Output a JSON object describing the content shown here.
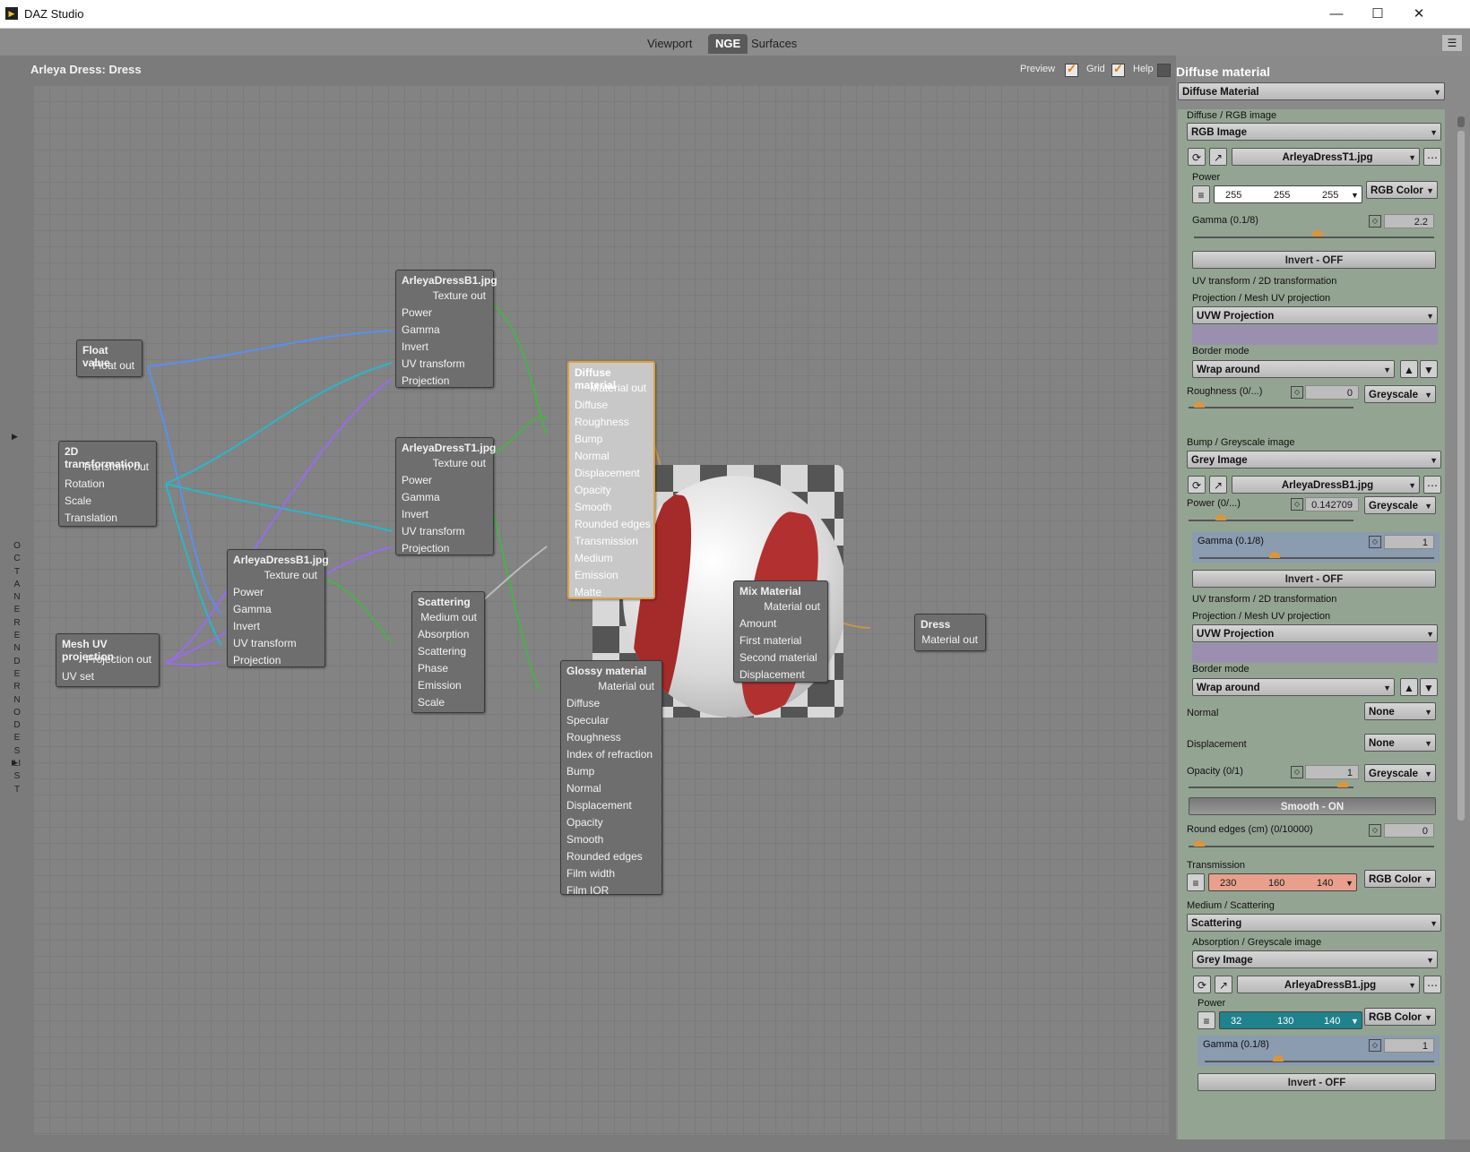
{
  "window": {
    "title": "DAZ Studio",
    "minimize": "—",
    "maximize": "☐",
    "close": "✕"
  },
  "tabs": [
    "Viewport",
    "NGE",
    "Surfaces"
  ],
  "header": {
    "node_title": "Arleya Dress: Dress",
    "preview_label": "Preview",
    "grid_label": "Grid",
    "help_label": "Help"
  },
  "sidebar": {
    "label": "OCTANE RENDER NODES LIST"
  },
  "nodes": {
    "float_value": {
      "title": "Float value",
      "out": "Float out"
    },
    "transform2d": {
      "title": "2D transformation",
      "out": "Transform out",
      "inputs": [
        "Rotation",
        "Scale",
        "Translation"
      ]
    },
    "mesh_uv": {
      "title": "Mesh UV projection",
      "out": "Projection out",
      "inputs": [
        "UV set"
      ]
    },
    "b1_top": {
      "title": "ArleyaDressB1.jpg",
      "out": "Texture out",
      "inputs": [
        "Power",
        "Gamma",
        "Invert",
        "UV transform",
        "Projection"
      ]
    },
    "t1": {
      "title": "ArleyaDressT1.jpg",
      "out": "Texture out",
      "inputs": [
        "Power",
        "Gamma",
        "Invert",
        "UV transform",
        "Projection"
      ]
    },
    "b1_bottom": {
      "title": "ArleyaDressB1.jpg",
      "out": "Texture out",
      "inputs": [
        "Power",
        "Gamma",
        "Invert",
        "UV transform",
        "Projection"
      ]
    },
    "scattering": {
      "title": "Scattering",
      "out": "Medium out",
      "inputs": [
        "Absorption",
        "Scattering",
        "Phase",
        "Emission",
        "Scale"
      ]
    },
    "diffuse": {
      "title": "Diffuse material",
      "out": "Material out",
      "inputs": [
        "Diffuse",
        "Roughness",
        "Bump",
        "Normal",
        "Displacement",
        "Opacity",
        "Smooth",
        "Rounded edges",
        "Transmission",
        "Medium",
        "Emission",
        "Matte"
      ]
    },
    "glossy": {
      "title": "Glossy material",
      "out": "Material out",
      "inputs": [
        "Diffuse",
        "Specular",
        "Roughness",
        "Index of refraction",
        "Bump",
        "Normal",
        "Displacement",
        "Opacity",
        "Smooth",
        "Rounded edges",
        "Film width",
        "Film IOR"
      ]
    },
    "mix": {
      "title": "Mix Material",
      "out": "Material out",
      "inputs": [
        "Amount",
        "First material",
        "Second material",
        "Displacement"
      ]
    },
    "dress": {
      "title": "Dress",
      "out": "Material out"
    }
  },
  "panel": {
    "title": "Diffuse material",
    "material_type": "Diffuse Material",
    "diffuse": {
      "label": "Diffuse / RGB image",
      "type": "RGB Image",
      "file": "ArleyaDressT1.jpg",
      "power_label": "Power",
      "power": [
        "255",
        "255",
        "255"
      ],
      "power_mode": "RGB Color",
      "gamma_label": "Gamma (0.1/8)",
      "gamma": "2.2",
      "invert": "Invert - OFF",
      "uv_label": "UV transform / 2D transformation",
      "proj_label": "Projection / Mesh UV projection",
      "proj": "UVW Projection",
      "border_label": "Border mode",
      "border": "Wrap around"
    },
    "roughness": {
      "label": "Roughness (0/...)",
      "value": "0",
      "mode": "Greyscale"
    },
    "bump": {
      "label": "Bump / Greyscale image",
      "type": "Grey Image",
      "file": "ArleyaDressB1.jpg",
      "power_label": "Power (0/...)",
      "power": "0.142709",
      "power_mode": "Greyscale",
      "gamma_label": "Gamma (0.1/8)",
      "gamma": "1",
      "invert": "Invert - OFF",
      "uv_label": "UV transform / 2D transformation",
      "proj_label": "Projection / Mesh UV projection",
      "proj": "UVW Projection",
      "border_label": "Border mode",
      "border": "Wrap around"
    },
    "normal": {
      "label": "Normal",
      "value": "None"
    },
    "displacement": {
      "label": "Displacement",
      "value": "None"
    },
    "opacity": {
      "label": "Opacity (0/1)",
      "value": "1",
      "mode": "Greyscale"
    },
    "smooth": "Smooth - ON",
    "round_edges": {
      "label": "Round edges (cm) (0/10000)",
      "value": "0"
    },
    "transmission": {
      "label": "Transmission",
      "values": [
        "230",
        "160",
        "140"
      ],
      "mode": "RGB Color",
      "color": "#e8a08c"
    },
    "medium": {
      "label": "Medium / Scattering",
      "type": "Scattering"
    },
    "absorption": {
      "label": "Absorption / Greyscale image",
      "type": "Grey Image",
      "file": "ArleyaDressB1.jpg",
      "power_label": "Power",
      "power": [
        "32",
        "130",
        "140"
      ],
      "power_mode": "RGB Color",
      "color": "#20828c",
      "gamma_label": "Gamma (0.1/8)",
      "gamma": "1",
      "invert": "Invert - OFF"
    }
  }
}
